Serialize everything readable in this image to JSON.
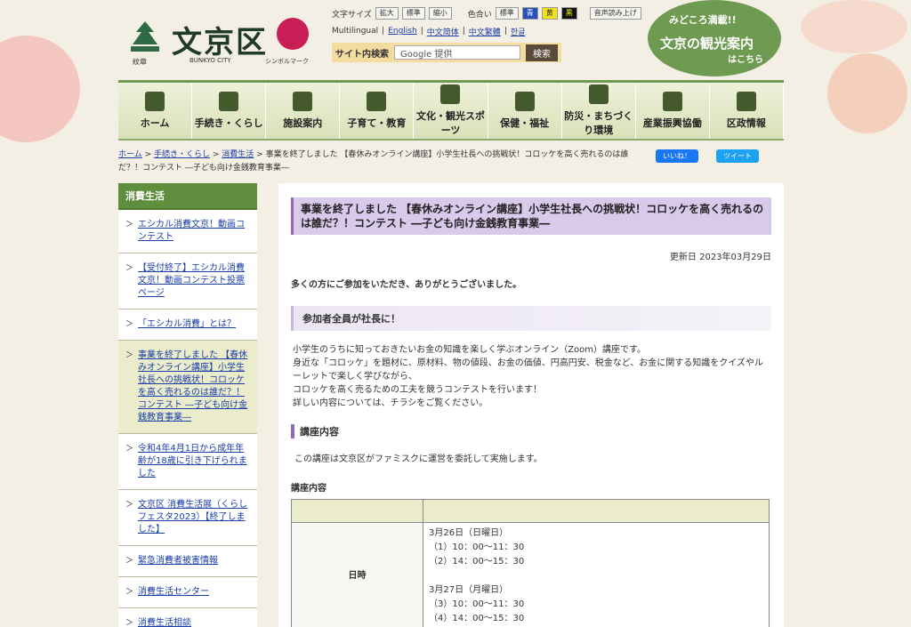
{
  "header": {
    "logo_title": "文京区",
    "logo_sub_crest": "紋章",
    "logo_sub_en": "BUNKYO CITY",
    "logo_sub_symbol": "シンボルマーク",
    "font_size_label": "文字サイズ",
    "font_buttons": [
      "拡大",
      "標準",
      "縮小"
    ],
    "color_label": "色合い",
    "color_buttons": [
      "標準",
      "青",
      "黄",
      "黒"
    ],
    "read_aloud": "音声読み上げ",
    "multilingual_label": "Multilingual",
    "languages": [
      "English",
      "中文简体",
      "中文繁體",
      "한글"
    ],
    "search_label": "サイト内検索",
    "search_placeholder": "Google 提供",
    "search_button": "検索",
    "tour": {
      "line1": "みどころ満載!!",
      "line2": "文京の観光案内",
      "line3": "はこちら"
    }
  },
  "nav": [
    {
      "label": "ホーム",
      "icon": "home-icon"
    },
    {
      "label": "手続き・くらし",
      "icon": "pencil-icon"
    },
    {
      "label": "施設案内",
      "icon": "building-icon"
    },
    {
      "label": "子育て・教育",
      "icon": "backpack-icon"
    },
    {
      "label": "文化・観光スポーツ",
      "icon": "temple-icon"
    },
    {
      "label": "保健・福祉",
      "icon": "hands-heart-icon"
    },
    {
      "label": "防災・まちづくり環境",
      "icon": "safety-icon"
    },
    {
      "label": "産業振興協働",
      "icon": "handshake-icon"
    },
    {
      "label": "区政情報",
      "icon": "document-icon"
    }
  ],
  "breadcrumb": {
    "home": "ホーム",
    "l1": "手続き・くらし",
    "l2": "消費生活",
    "current": "事業を終了しました 【春休みオンライン講座】小学生社長への挑戦状！コロッケを高く売れるのは誰だ？！コンテスト ―子ども向け金銭教育事業―"
  },
  "social": {
    "like": "いいね！",
    "tweet": "ツイート"
  },
  "sidebar": {
    "heading": "消費生活",
    "items": [
      "エシカル消費文京！動画コンテスト",
      "【受付終了】エシカル消費文京！動画コンテスト投票ページ",
      "「エシカル消費」とは？",
      "事業を終了しました 【春休みオンライン講座】小学生社長への挑戦状！コロッケを高く売れるのは誰だ？！コンテスト ―子ども向け金銭教育事業―",
      "令和4年4月1日から成年年齢が18歳に引き下げられました",
      "文京区 消費生活展（くらしフェスタ2023）【終了しました】",
      "緊急消費者被害情報",
      "消費生活センター",
      "消費生活相談"
    ]
  },
  "main": {
    "title": "事業を終了しました 【春休みオンライン講座】小学生社長への挑戦状！コロッケを高く売れるのは誰だ？！コンテスト ―子ども向け金銭教育事業―",
    "updated": "更新日 2023年03月29日",
    "thanks": "多くの方にご参加をいただき、ありがとうございました。",
    "h2": "参加者全員が社長に！",
    "body": [
      "小学生のうちに知っておきたいお金の知識を楽しく学ぶオンライン（Zoom）講座です。",
      "身近な「コロッケ」を題材に、原材料、物の値段、お金の価値、円高円安、税金など、お金に関する知識をクイズやルーレットで楽しく学びながら、",
      "コロッケを高く売るための工夫を競うコンテストを行います！",
      "詳しい内容については、チラシをご覧ください。"
    ],
    "h3": "講座内容",
    "note": "この講座は文京区がファミスクに運営を委託して実施します。",
    "table_caption": "講座内容",
    "table": {
      "row_label": "日時",
      "lines": [
        "3月26日（日曜日）",
        "（1）10：00～11：30",
        "（2）14：00～15：30",
        "",
        "3月27日（月曜日）",
        "（3）10：00～11：30",
        "（4）14：00～15：30"
      ]
    }
  }
}
